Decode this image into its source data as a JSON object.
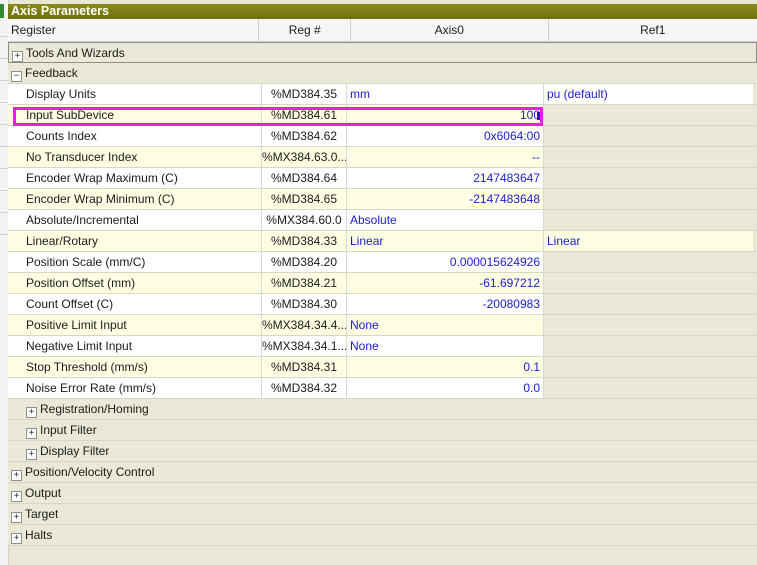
{
  "title": "Axis Parameters",
  "columns": {
    "register": "Register",
    "reg_num": "Reg #",
    "axis0": "Axis0",
    "ref1": "Ref1"
  },
  "groups": {
    "tools": "Tools And Wizards",
    "feedback": "Feedback",
    "registration": "Registration/Homing",
    "input_filter": "Input Filter",
    "display_filter": "Display Filter",
    "position_velocity": "Position/Velocity Control",
    "output": "Output",
    "target": "Target",
    "halts": "Halts"
  },
  "expander_collapsed": "+",
  "expander_expanded": "−",
  "rows": [
    {
      "name": "Display Units",
      "reg": "%MD384.35",
      "axis0": "mm",
      "ref1": "pu (default)"
    },
    {
      "name": "Input SubDevice",
      "reg": "%MD384.61",
      "axis0": "100",
      "ref1": ""
    },
    {
      "name": "Counts Index",
      "reg": "%MD384.62",
      "axis0": "0x6064:00",
      "ref1": ""
    },
    {
      "name": "No Transducer Index",
      "reg": "%MX384.63.0...",
      "axis0": "--",
      "ref1": ""
    },
    {
      "name": "Encoder Wrap Maximum (C)",
      "reg": "%MD384.64",
      "axis0": "2147483647",
      "ref1": ""
    },
    {
      "name": "Encoder Wrap Minimum (C)",
      "reg": "%MD384.65",
      "axis0": "-2147483648",
      "ref1": ""
    },
    {
      "name": "Absolute/Incremental",
      "reg": "%MX384.60.0",
      "axis0": "Absolute",
      "ref1": ""
    },
    {
      "name": "Linear/Rotary",
      "reg": "%MD384.33",
      "axis0": "Linear",
      "ref1": "Linear"
    },
    {
      "name": "Position Scale (mm/C)",
      "reg": "%MD384.20",
      "axis0": "0.000015624926",
      "ref1": ""
    },
    {
      "name": "Position Offset (mm)",
      "reg": "%MD384.21",
      "axis0": "-61.697212",
      "ref1": ""
    },
    {
      "name": "Count Offset (C)",
      "reg": "%MD384.30",
      "axis0": "-20080983",
      "ref1": ""
    },
    {
      "name": "Positive Limit Input",
      "reg": "%MX384.34.4...",
      "axis0": "None",
      "ref1": ""
    },
    {
      "name": "Negative Limit Input",
      "reg": "%MX384.34.1...",
      "axis0": "None",
      "ref1": ""
    },
    {
      "name": "Stop Threshold (mm/s)",
      "reg": "%MD384.31",
      "axis0": "0.1",
      "ref1": ""
    },
    {
      "name": "Noise Error Rate (mm/s)",
      "reg": "%MD384.32",
      "axis0": "0.0",
      "ref1": ""
    }
  ],
  "colors": {
    "title_bar": "#7d7d14",
    "highlight": "#e81ee2",
    "value_text": "#1c1ccf"
  }
}
